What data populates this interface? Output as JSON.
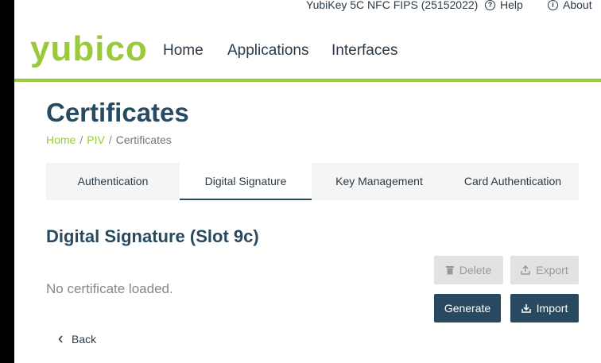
{
  "header": {
    "device": "YubiKey 5C NFC FIPS (25152022)",
    "help_label": "Help",
    "about_label": "About",
    "logo": "yubico",
    "nav": [
      "Home",
      "Applications",
      "Interfaces"
    ]
  },
  "page": {
    "title": "Certificates",
    "breadcrumb": [
      "Home",
      "PIV",
      "Certificates"
    ],
    "breadcrumb_sep": "/"
  },
  "tabs": [
    {
      "label": "Authentication",
      "active": false
    },
    {
      "label": "Digital Signature",
      "active": true
    },
    {
      "label": "Key Management",
      "active": false
    },
    {
      "label": "Card Authentication",
      "active": false
    }
  ],
  "slot": {
    "title": "Digital Signature (Slot 9c)",
    "empty_message": "No certificate loaded."
  },
  "buttons": {
    "delete": "Delete",
    "export": "Export",
    "generate": "Generate",
    "import": "Import"
  },
  "back_label": "Back",
  "colors": {
    "brand_green": "#9aca3c",
    "primary": "#284a60",
    "disabled": "#e2e2e2"
  }
}
